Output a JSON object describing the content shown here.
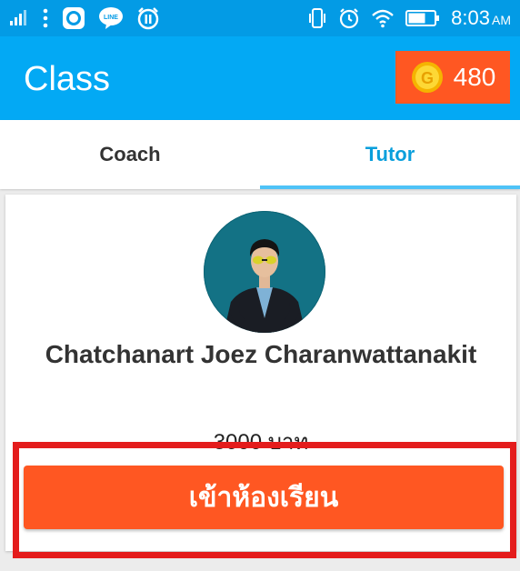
{
  "status_bar": {
    "time": "8:03",
    "ampm": "AM",
    "icons_left": [
      "signal-icon",
      "more-vert-icon",
      "camera-app-icon",
      "line-app-icon",
      "alarm-app-icon"
    ],
    "icons_right": [
      "vibrate-icon",
      "alarm-icon",
      "wifi-icon",
      "battery-icon"
    ]
  },
  "app_bar": {
    "title": "Class",
    "coin_count": "480"
  },
  "tabs": [
    {
      "label": "Coach",
      "selected": false
    },
    {
      "label": "Tutor",
      "selected": true
    }
  ],
  "tutor_card": {
    "name": "Chatchanart Joez Charanwattanakit",
    "price": "3000 บาท"
  },
  "enter_button": {
    "label": "เข้าห้องเรียน"
  },
  "colors": {
    "status_bar": "#039be5",
    "app_bar": "#03a9f4",
    "accent_orange": "#ff5722",
    "highlight_red": "#e41c1c",
    "tab_active": "#0a9fdc"
  }
}
